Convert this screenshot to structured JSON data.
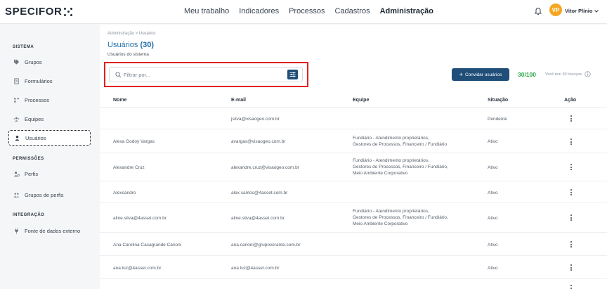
{
  "nav": {
    "logo": "SPECIFOR",
    "items": [
      {
        "label": "Meu trabalho",
        "active": false
      },
      {
        "label": "Indicadores",
        "active": false
      },
      {
        "label": "Processos",
        "active": false
      },
      {
        "label": "Cadastros",
        "active": false
      },
      {
        "label": "Administração",
        "active": true
      }
    ],
    "user": {
      "initials": "VP",
      "name": "Vitor Plínio"
    }
  },
  "sidebar": {
    "sections": [
      {
        "title": "SISTEMA",
        "items": [
          {
            "label": "Grupos",
            "icon": "tag-icon"
          },
          {
            "label": "Formulários",
            "icon": "document-icon"
          },
          {
            "label": "Processos",
            "icon": "process-icon"
          },
          {
            "label": "Equipes",
            "icon": "team-icon"
          },
          {
            "label": "Usuários",
            "icon": "user-icon",
            "active": true
          }
        ]
      },
      {
        "title": "PERMISSÕES",
        "items": [
          {
            "label": "Perfis",
            "icon": "profile-icon"
          },
          {
            "label": "Grupos de perfis",
            "icon": "profile-group-icon"
          }
        ]
      },
      {
        "title": "INTEGRAÇÃO",
        "items": [
          {
            "label": "Fonte de dados externo",
            "icon": "plug-icon"
          }
        ]
      }
    ]
  },
  "page": {
    "breadcrumb": "Administração > Usuários",
    "title_text": "Usuários",
    "title_count": "(30)",
    "subtitle": "Usuários do sistema",
    "search_placeholder": "Filtrar por...",
    "invite_label": "Convidar usuários",
    "quota": "30/100",
    "quota_note": "Você tem 30 licenças"
  },
  "table": {
    "headers": [
      "Nome",
      "E-mail",
      "Equipe",
      "Situação",
      "Ação"
    ],
    "rows": [
      {
        "nome": "",
        "email": "jsilva@visaogeo.com.br",
        "equipe": [],
        "situacao": "Pendente"
      },
      {
        "nome": "Alexa Godoy Vargas",
        "email": "avargas@visaogeo.com.br",
        "equipe": [
          "Fundiário - Atendimento proprietários,",
          "Gestores de Processos, Financeiro / Fundiário"
        ],
        "situacao": "Ativo"
      },
      {
        "nome": "Alexandre Cruz",
        "email": "alexandre.cruz@visaogeo.com.br",
        "equipe": [
          "Fundiário - Atendimento proprietários,",
          "Gestores de Processos, Financeiro / Fundiário,",
          "Meio Ambiente Corporativo"
        ],
        "situacao": "Ativo"
      },
      {
        "nome": "Alexsandro",
        "email": "alex.santos@4asset.com.br",
        "equipe": [],
        "situacao": "Ativo"
      },
      {
        "nome": "aline.silva@4asset.com.br",
        "email": "aline.silva@4asset.com.br",
        "equipe": [
          "Fundiário - Atendimento proprietários,",
          "Gestores de Processos, Financeiro / Fundiário,",
          "Meio Ambiente Corporativo"
        ],
        "situacao": "Ativo"
      },
      {
        "nome": "Ana Carolina Casagrande Carioni",
        "email": "ana.carioni@grupoverante.com.br",
        "equipe": [],
        "situacao": "Ativo"
      },
      {
        "nome": "ana.luz@4asset.com.br",
        "email": "ana.luz@4asset.com.br",
        "equipe": [],
        "situacao": "Ativo"
      }
    ]
  }
}
